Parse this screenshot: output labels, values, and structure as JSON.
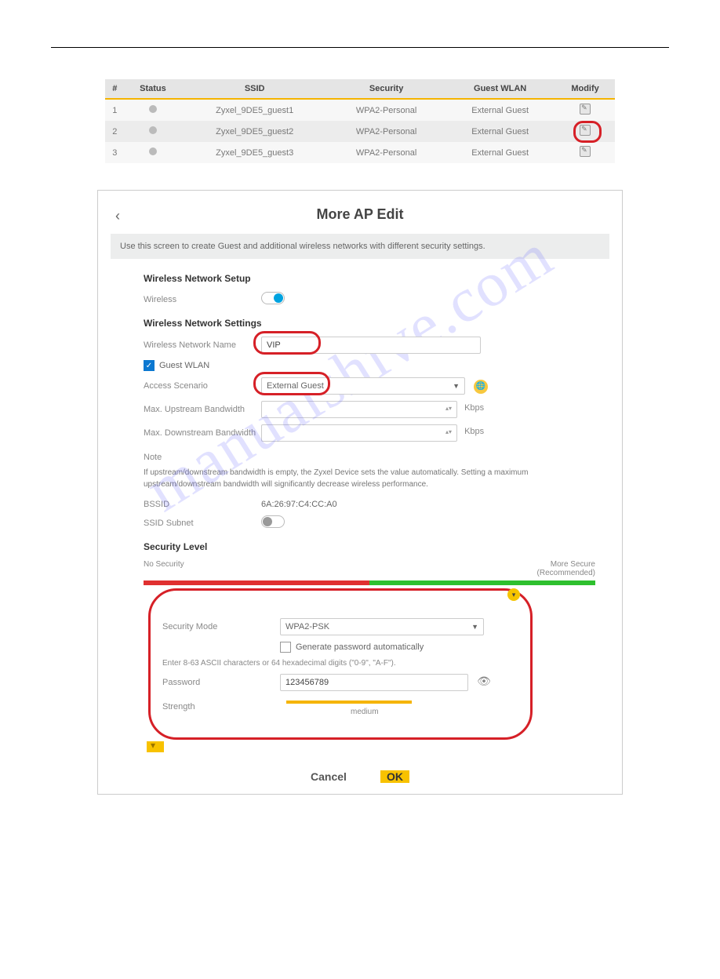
{
  "watermark": "manualshive.com",
  "table": {
    "headers": {
      "num": "#",
      "status": "Status",
      "ssid": "SSID",
      "security": "Security",
      "guest": "Guest WLAN",
      "modify": "Modify"
    },
    "rows": [
      {
        "num": "1",
        "ssid": "Zyxel_9DE5_guest1",
        "security": "WPA2-Personal",
        "guest": "External Guest"
      },
      {
        "num": "2",
        "ssid": "Zyxel_9DE5_guest2",
        "security": "WPA2-Personal",
        "guest": "External Guest"
      },
      {
        "num": "3",
        "ssid": "Zyxel_9DE5_guest3",
        "security": "WPA2-Personal",
        "guest": "External Guest"
      }
    ]
  },
  "dialog": {
    "title": "More AP Edit",
    "notice": "Use this screen to create Guest and additional wireless networks with different security settings.",
    "setup_h": "Wireless Network Setup",
    "wireless_lbl": "Wireless",
    "settings_h": "Wireless Network Settings",
    "name_lbl": "Wireless Network Name",
    "name_val": "VIP",
    "guest_lbl": "Guest WLAN",
    "scenario_lbl": "Access Scenario",
    "scenario_val": "External Guest",
    "up_lbl": "Max. Upstream Bandwidth",
    "down_lbl": "Max. Downstream Bandwidth",
    "kbps": "Kbps",
    "note_h": "Note",
    "note_txt": "If upstream/downstream bandwidth is empty, the Zyxel Device sets the value automatically. Setting a maximum upstream/downstream bandwidth will significantly decrease wireless performance.",
    "bssid_lbl": "BSSID",
    "bssid_val": "6A:26:97:C4:CC:A0",
    "subnet_lbl": "SSID Subnet",
    "seclevel_h": "Security Level",
    "nosec": "No Security",
    "moresec1": "More Secure",
    "moresec2": "(Recommended)",
    "secmode_lbl": "Security Mode",
    "secmode_val": "WPA2-PSK",
    "genpw_lbl": "Generate password automatically",
    "pwhint": "Enter 8-63 ASCII characters or 64 hexadecimal digits (\"0-9\", \"A-F\").",
    "pw_lbl": "Password",
    "pw_val": "123456789",
    "strength_lbl": "Strength",
    "strength_val": "medium",
    "cancel": "Cancel",
    "ok": "OK"
  }
}
